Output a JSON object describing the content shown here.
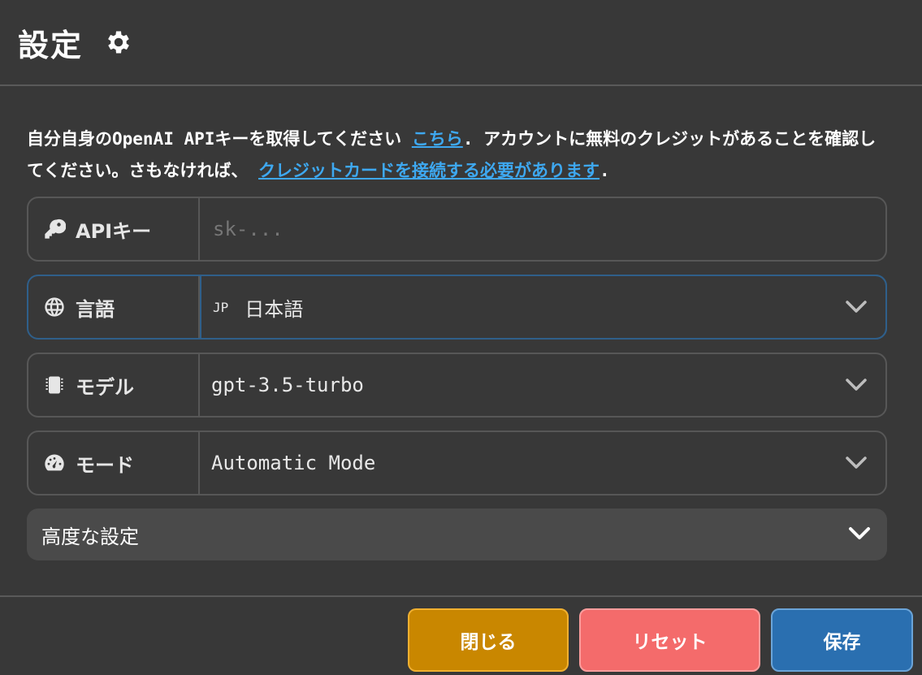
{
  "header": {
    "title": "設定",
    "icon": "gear-icon"
  },
  "description": {
    "text_before_link1": "自分自身のOpenAI APIキーを取得してください ",
    "link1": "こちら",
    "text_after_link1": ". アカウントに無料のクレジットがあることを確認してください。さもなければ、 ",
    "link2": "クレジットカードを接続する必要があります",
    "text_after_link2": "."
  },
  "fields": {
    "api_key": {
      "label": "APIキー",
      "icon": "key-icon",
      "value": "",
      "placeholder": "sk-..."
    },
    "language": {
      "label": "言語",
      "icon": "globe-icon",
      "flag": "JP",
      "value": "日本語"
    },
    "model": {
      "label": "モデル",
      "icon": "chip-icon",
      "value": "gpt-3.5-turbo"
    },
    "mode": {
      "label": "モード",
      "icon": "speedometer-icon",
      "value": "Automatic Mode"
    }
  },
  "advanced": {
    "label": "高度な設定"
  },
  "footer": {
    "close_label": "閉じる",
    "reset_label": "リセット",
    "save_label": "保存"
  },
  "colors": {
    "background": "#383838",
    "link": "#3ea8f0",
    "close_button": "#c98700",
    "reset_button": "#f46b6b",
    "save_button": "#2a6fb0",
    "focus_border": "#2f5f8a"
  }
}
